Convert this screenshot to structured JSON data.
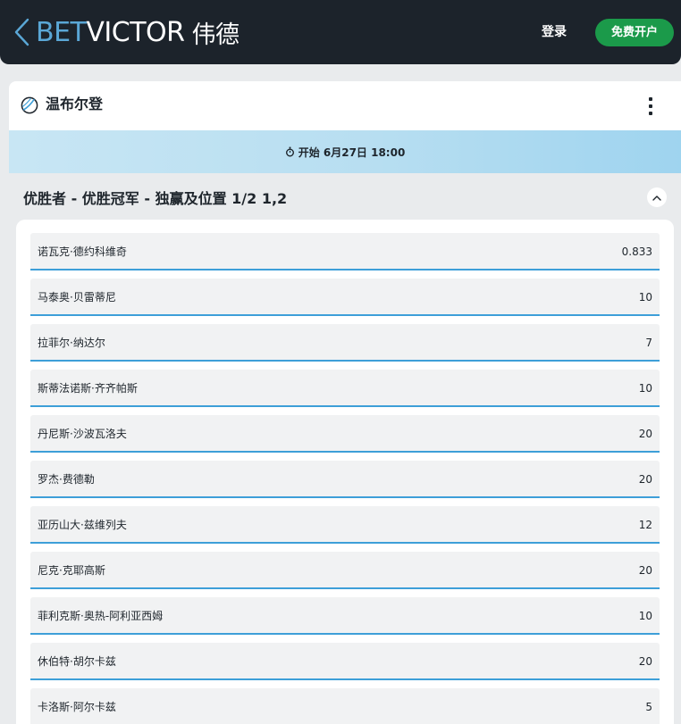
{
  "header": {
    "logo_bet": "BET",
    "logo_victor": "VICTOR",
    "logo_cn": "伟德",
    "login_label": "登录",
    "register_label": "免费开户",
    "colors": {
      "bar": "#1c232b",
      "brand_blue": "#5aa7d6",
      "register_green": "#1b9a4a"
    },
    "icons": {
      "back": "chevron-left-icon"
    }
  },
  "event": {
    "title": "温布尔登",
    "start_text": "开始 6月27日 18:00",
    "icons": {
      "sport": "tennis-ball-icon",
      "menu": "kebab-menu-icon",
      "time": "stopwatch-icon"
    }
  },
  "market": {
    "title": "优胜者 - 优胜冠军 - 独赢及位置 1/2 1,2",
    "icons": {
      "toggle": "chevron-up-icon"
    }
  },
  "selections": [
    {
      "name": "诺瓦克·德约科维奇",
      "odds": "0.833"
    },
    {
      "name": "马泰奥·贝雷蒂尼",
      "odds": "10"
    },
    {
      "name": "拉菲尔·纳达尔",
      "odds": "7"
    },
    {
      "name": "斯蒂法诺斯·齐齐帕斯",
      "odds": "10"
    },
    {
      "name": "丹尼斯·沙波瓦洛夫",
      "odds": "20"
    },
    {
      "name": "罗杰·费德勒",
      "odds": "20"
    },
    {
      "name": "亚历山大·兹维列夫",
      "odds": "12"
    },
    {
      "name": "尼克·克耶高斯",
      "odds": "20"
    },
    {
      "name": "菲利克斯·奥热-阿利亚西姆",
      "odds": "10"
    },
    {
      "name": "休伯特·胡尔卡兹",
      "odds": "20"
    },
    {
      "name": "卡洛斯·阿尔卡兹",
      "odds": "5"
    }
  ]
}
